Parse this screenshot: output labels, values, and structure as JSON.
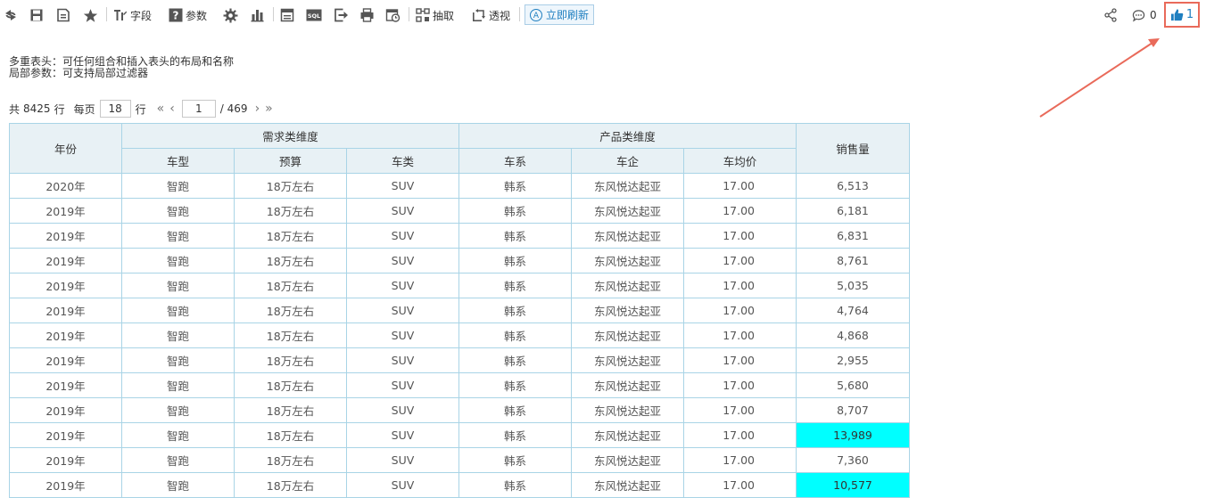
{
  "toolbar": {
    "field_label": "字段",
    "param_label": "参数",
    "extract_label": "抽取",
    "pivot_label": "透视",
    "refresh_now_label": "立即刷新",
    "sql_label": "SQL",
    "comment_count": "0",
    "like_count": "1"
  },
  "description": {
    "line1": "多重表头：可任何组合和插入表头的布局和名称",
    "line2": "局部参数：可支持局部过滤器"
  },
  "pager": {
    "total_prefix": "共",
    "total_rows": "8425",
    "row_unit": "行",
    "per_page_label": "每页",
    "page_size": "18",
    "page_size_unit": "行",
    "current_page": "1",
    "total_pages": "/ 469"
  },
  "table": {
    "header_year": "年份",
    "group_demand": "需求类维度",
    "group_product": "产品类维度",
    "header_sales": "销售量",
    "sub_headers": [
      "车型",
      "预算",
      "车类",
      "车系",
      "车企",
      "车均价"
    ],
    "rows": [
      [
        "2020年",
        "智跑",
        "18万左右",
        "SUV",
        "韩系",
        "东风悦达起亚",
        "17.00",
        "6,513"
      ],
      [
        "2019年",
        "智跑",
        "18万左右",
        "SUV",
        "韩系",
        "东风悦达起亚",
        "17.00",
        "6,181"
      ],
      [
        "2019年",
        "智跑",
        "18万左右",
        "SUV",
        "韩系",
        "东风悦达起亚",
        "17.00",
        "6,831"
      ],
      [
        "2019年",
        "智跑",
        "18万左右",
        "SUV",
        "韩系",
        "东风悦达起亚",
        "17.00",
        "8,761"
      ],
      [
        "2019年",
        "智跑",
        "18万左右",
        "SUV",
        "韩系",
        "东风悦达起亚",
        "17.00",
        "5,035"
      ],
      [
        "2019年",
        "智跑",
        "18万左右",
        "SUV",
        "韩系",
        "东风悦达起亚",
        "17.00",
        "4,764"
      ],
      [
        "2019年",
        "智跑",
        "18万左右",
        "SUV",
        "韩系",
        "东风悦达起亚",
        "17.00",
        "4,868"
      ],
      [
        "2019年",
        "智跑",
        "18万左右",
        "SUV",
        "韩系",
        "东风悦达起亚",
        "17.00",
        "2,955"
      ],
      [
        "2019年",
        "智跑",
        "18万左右",
        "SUV",
        "韩系",
        "东风悦达起亚",
        "17.00",
        "5,680"
      ],
      [
        "2019年",
        "智跑",
        "18万左右",
        "SUV",
        "韩系",
        "东风悦达起亚",
        "17.00",
        "8,707"
      ],
      [
        "2019年",
        "智跑",
        "18万左右",
        "SUV",
        "韩系",
        "东风悦达起亚",
        "17.00",
        "13,989"
      ],
      [
        "2019年",
        "智跑",
        "18万左右",
        "SUV",
        "韩系",
        "东风悦达起亚",
        "17.00",
        "7,360"
      ],
      [
        "2019年",
        "智跑",
        "18万左右",
        "SUV",
        "韩系",
        "东风悦达起亚",
        "17.00",
        "10,577"
      ]
    ],
    "highlighted_sales_rows": [
      10,
      12
    ]
  },
  "colors": {
    "highlight": "#00ffff",
    "header_bg": "#e8f1f5",
    "border": "#a9d4e6",
    "accent": "#1f7fc0",
    "annotation": "#e96a5a"
  },
  "icons": [
    "refresh-icon",
    "save-icon",
    "save-as-icon",
    "favorite-star-icon",
    "field-icon",
    "param-icon",
    "settings-gear-icon",
    "chart-icon",
    "layout-icon",
    "sql-icon",
    "export-icon",
    "print-icon",
    "schedule-icon",
    "extract-icon",
    "pivot-icon",
    "refresh-now-icon",
    "share-icon",
    "comment-icon",
    "like-thumb-icon"
  ]
}
